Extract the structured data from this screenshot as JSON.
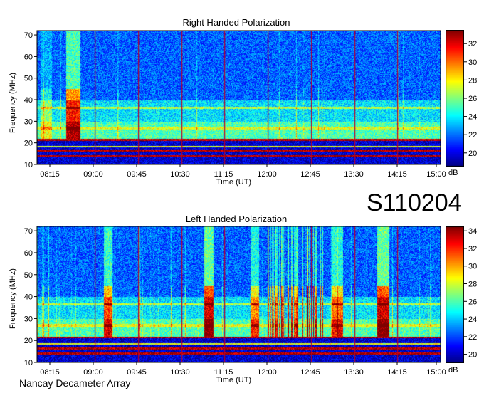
{
  "figure_label": "S110204",
  "credit": "Nancay Decameter Array",
  "chart_data": [
    {
      "type": "heatmap",
      "title": "Right Handed Polarization",
      "xlabel": "Time (UT)",
      "ylabel": "Frequency (MHz)",
      "x_ticks": [
        "08:15",
        "09:00",
        "09:45",
        "10:30",
        "11:15",
        "12:00",
        "12:45",
        "13:30",
        "14:15",
        "15:00"
      ],
      "y_ticks": [
        10,
        20,
        30,
        40,
        50,
        60,
        70
      ],
      "ylim": [
        10,
        72
      ],
      "xlim_hours": [
        8.0,
        15.0
      ],
      "colorbar": {
        "unit": "dB",
        "ticks": [
          20,
          22,
          24,
          26,
          28,
          30,
          32
        ],
        "range": [
          18.5,
          33.5
        ]
      },
      "colormap": [
        "#00007f",
        "#0000ff",
        "#007fff",
        "#00ffff",
        "#7fff7f",
        "#ffff00",
        "#ff7f00",
        "#ff0000",
        "#7f0000"
      ],
      "markers_hours": [
        9.0,
        9.75,
        10.5,
        11.25,
        12.0,
        12.75,
        13.5,
        14.25
      ]
    },
    {
      "type": "heatmap",
      "title": "Left Handed Polarization",
      "xlabel": "Time (UT)",
      "ylabel": "Frequency (MHz)",
      "x_ticks": [
        "08:15",
        "09:00",
        "09:45",
        "10:30",
        "11:15",
        "12:00",
        "12:45",
        "13:30",
        "14:15",
        "15:00"
      ],
      "y_ticks": [
        10,
        20,
        30,
        40,
        50,
        60,
        70
      ],
      "ylim": [
        10,
        72
      ],
      "xlim_hours": [
        8.0,
        15.0
      ],
      "colorbar": {
        "unit": "dB",
        "ticks": [
          20,
          22,
          24,
          26,
          28,
          30,
          32,
          34
        ],
        "range": [
          19,
          34.5
        ]
      },
      "colormap": [
        "#00007f",
        "#0000ff",
        "#007fff",
        "#00ffff",
        "#7fff7f",
        "#ffff00",
        "#ff7f00",
        "#ff0000",
        "#7f0000"
      ],
      "markers_hours": [
        9.0,
        9.75,
        10.5,
        11.25,
        12.0,
        12.75,
        13.5,
        14.25
      ]
    }
  ]
}
